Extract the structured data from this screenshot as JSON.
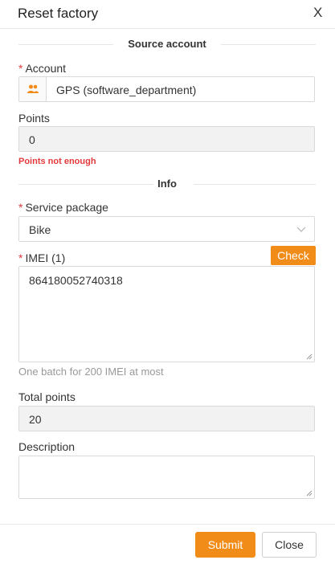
{
  "dialog": {
    "title": "Reset factory",
    "close_glyph": "X"
  },
  "source_section": {
    "title": "Source account"
  },
  "account": {
    "label": "Account",
    "value": "GPS (software_department)",
    "icon": "users-icon"
  },
  "points": {
    "label": "Points",
    "value": "0",
    "error": "Points not enough"
  },
  "info_section": {
    "title": "Info"
  },
  "service_package": {
    "label": "Service package",
    "value": "Bike"
  },
  "imei": {
    "label": "IMEI (1)",
    "check_label": "Check",
    "value": "864180052740318",
    "hint": "One batch for 200 IMEI at most"
  },
  "total_points": {
    "label": "Total points",
    "value": "20"
  },
  "description": {
    "label": "Description",
    "value": ""
  },
  "footer": {
    "submit_label": "Submit",
    "close_label": "Close"
  },
  "colors": {
    "accent": "#f28c18",
    "required": "#e4393c",
    "disabled_bg": "#f2f2f2"
  }
}
